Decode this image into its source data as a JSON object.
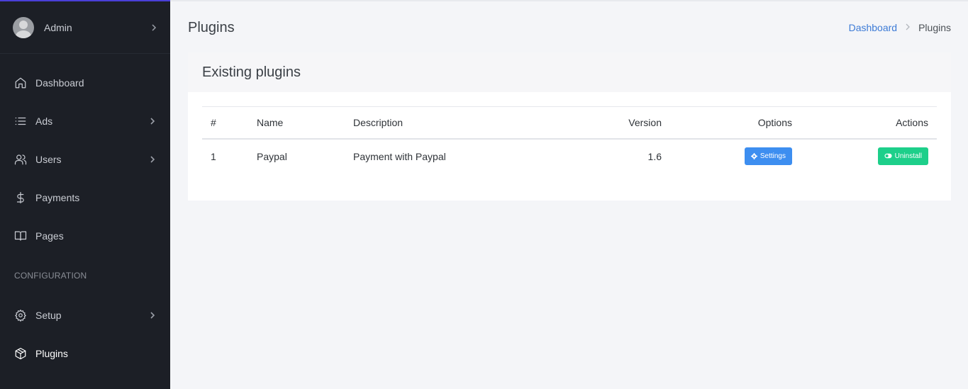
{
  "user": {
    "name": "Admin"
  },
  "sidebar": {
    "items": [
      {
        "label": "Dashboard",
        "icon": "home-icon",
        "has_submenu": false
      },
      {
        "label": "Ads",
        "icon": "list-icon",
        "has_submenu": true
      },
      {
        "label": "Users",
        "icon": "users-icon",
        "has_submenu": true
      },
      {
        "label": "Payments",
        "icon": "dollar-icon",
        "has_submenu": false
      },
      {
        "label": "Pages",
        "icon": "book-icon",
        "has_submenu": false
      }
    ],
    "section_title": "CONFIGURATION",
    "config_items": [
      {
        "label": "Setup",
        "icon": "gear-icon",
        "has_submenu": true
      },
      {
        "label": "Plugins",
        "icon": "box-icon",
        "has_submenu": false,
        "active": true
      }
    ]
  },
  "header": {
    "title": "Plugins",
    "breadcrumb": [
      "Dashboard",
      "Plugins"
    ]
  },
  "card": {
    "title": "Existing plugins",
    "columns": [
      "#",
      "Name",
      "Description",
      "Version",
      "Options",
      "Actions"
    ],
    "rows": [
      {
        "num": "1",
        "name": "Paypal",
        "description": "Payment with Paypal",
        "version": "1.6",
        "option_label": "Settings",
        "action_label": "Uninstall"
      }
    ]
  },
  "colors": {
    "sidebar_bg": "#1c1f26",
    "accent_blue": "#3d8ef0",
    "accent_green": "#1dcf8a",
    "link": "#3d7bd6"
  }
}
